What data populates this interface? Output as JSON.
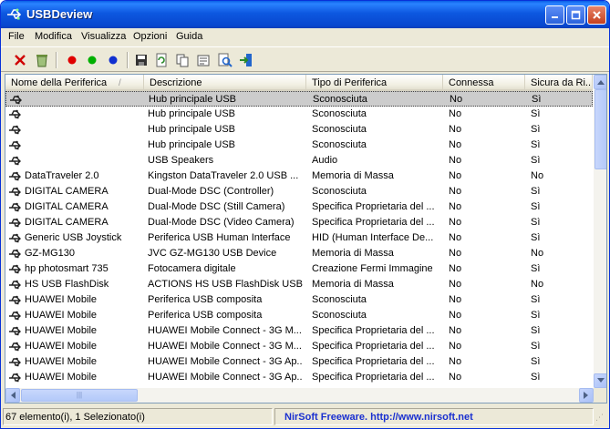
{
  "window": {
    "title": "USBDeview",
    "icon": "usb-app-icon"
  },
  "window_controls": {
    "minimize": "minimize-icon",
    "maximize": "maximize-icon",
    "close": "close-icon"
  },
  "menu": [
    "File",
    "Modifica",
    "Visualizza",
    "Opzioni",
    "Guida"
  ],
  "toolbar": [
    {
      "icon": "disconnect-icon",
      "color": "#d00000"
    },
    {
      "icon": "uninstall-icon",
      "color": "#6a8f3a"
    },
    {
      "icon": "red-dot-icon",
      "color": "#e00000"
    },
    {
      "icon": "green-dot-icon",
      "color": "#00b000"
    },
    {
      "icon": "blue-dot-icon",
      "color": "#1030d0"
    },
    {
      "icon": "save-icon",
      "color": "#333"
    },
    {
      "icon": "refresh-icon",
      "color": "#2a8a2a"
    },
    {
      "icon": "copy-icon",
      "color": "#555"
    },
    {
      "icon": "properties-icon",
      "color": "#555"
    },
    {
      "icon": "find-icon",
      "color": "#2266cc"
    },
    {
      "icon": "exit-icon",
      "color": "#2266cc"
    }
  ],
  "columns": [
    "Nome della Periferica",
    "Descrizione",
    "Tipo di Periferica",
    "Connessa",
    "Sicura da Ri..."
  ],
  "sort_indicator": "/",
  "rows": [
    [
      "",
      "Hub principale USB",
      "Sconosciuta",
      "No",
      "Sì"
    ],
    [
      "",
      "Hub principale USB",
      "Sconosciuta",
      "No",
      "Sì"
    ],
    [
      "",
      "Hub principale USB",
      "Sconosciuta",
      "No",
      "Sì"
    ],
    [
      "",
      "Hub principale USB",
      "Sconosciuta",
      "No",
      "Sì"
    ],
    [
      "",
      "USB Speakers",
      "Audio",
      "No",
      "Sì"
    ],
    [
      "DataTraveler 2.0",
      "Kingston DataTraveler 2.0 USB ...",
      "Memoria di Massa",
      "No",
      "No"
    ],
    [
      "DIGITAL CAMERA",
      "Dual-Mode DSC (Controller)",
      "Sconosciuta",
      "No",
      "Sì"
    ],
    [
      "DIGITAL CAMERA",
      "Dual-Mode DSC (Still Camera)",
      "Specifica Proprietaria del ...",
      "No",
      "Sì"
    ],
    [
      "DIGITAL CAMERA",
      "Dual-Mode DSC (Video Camera)",
      "Specifica Proprietaria del ...",
      "No",
      "Sì"
    ],
    [
      "Generic  USB  Joystick",
      "Periferica USB Human Interface",
      "HID (Human Interface De...",
      "No",
      "Sì"
    ],
    [
      "GZ-MG130",
      "JVC GZ-MG130 USB Device",
      "Memoria di Massa",
      "No",
      "No"
    ],
    [
      "hp photosmart 735",
      "Fotocamera digitale",
      "Creazione Fermi Immagine",
      "No",
      "Sì"
    ],
    [
      "HS USB FlashDisk",
      "ACTIONS HS USB FlashDisk USB ...",
      "Memoria di Massa",
      "No",
      "No"
    ],
    [
      "HUAWEI Mobile",
      "Periferica USB composita",
      "Sconosciuta",
      "No",
      "Sì"
    ],
    [
      "HUAWEI Mobile",
      "Periferica USB composita",
      "Sconosciuta",
      "No",
      "Sì"
    ],
    [
      "HUAWEI Mobile",
      "HUAWEI Mobile Connect - 3G M...",
      "Specifica Proprietaria del ...",
      "No",
      "Sì"
    ],
    [
      "HUAWEI Mobile",
      "HUAWEI Mobile Connect - 3G M...",
      "Specifica Proprietaria del ...",
      "No",
      "Sì"
    ],
    [
      "HUAWEI Mobile",
      "HUAWEI Mobile Connect - 3G Ap...",
      "Specifica Proprietaria del ...",
      "No",
      "Sì"
    ],
    [
      "HUAWEI Mobile",
      "HUAWEI Mobile Connect - 3G Ap...",
      "Specifica Proprietaria del ...",
      "No",
      "Sì"
    ]
  ],
  "selected_row": 0,
  "status": {
    "count": "67 elemento(i), 1 Selezionato(i)",
    "credit": "NirSoft Freeware.  http://www.nirsoft.net"
  },
  "colors": {
    "titlebar": "#0a5fe6",
    "selection": "#cccccc",
    "credit_text": "#1a30d0"
  }
}
